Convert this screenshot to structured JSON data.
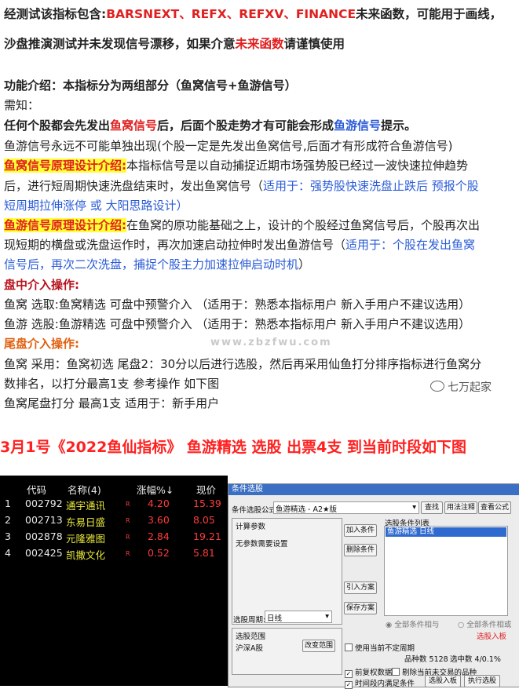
{
  "lines": {
    "l1_a": "经测试该指标包含:",
    "l1_b": "BARSNEXT、REFX、REFXV、FINANCE",
    "l1_c": "未来函数，可能用于画线，",
    "l2_a": "沙盘推演测试并未发现信号漂移，如果介意",
    "l2_b": "未来函数",
    "l2_c": "请谨慎使用",
    "l3": "功能介绍：本指标分为两组部分（鱼窝信号+鱼游信号）",
    "l4": "需知：",
    "l5_a": "任何个股都会先发出",
    "l5_b": "鱼窝信号",
    "l5_c": "后，后面个股走势才有可能会形成",
    "l5_d": "鱼游信号",
    "l5_e": "提示。",
    "l6": "鱼游信号永远不可能单独出现(个股一定是先发出鱼窝信号,后面才有形成符合鱼游信号)",
    "l7_a": "鱼窝信号原理设计介绍:",
    "l7_b": "本指标信号是以自动捕捉近期市场强势股已经过一波快速拉伸趋势",
    "l8_a": "后，进行短周期快速洗盘结束时，发出鱼窝信号（",
    "l8_b": "适用于：强势股快速洗盘止跌后 预报个股",
    "l9": "短周期拉伸涨停 或 大阳思路设计）",
    "l10_a": "鱼游信号原理设计介绍:",
    "l10_b": "在鱼窝的原功能基础之上，设计的个股经过鱼窝信号后，个股再次出",
    "l11_a": "现短期的横盘或洗盘运作时，再次加速启动拉伸时发出鱼游信号（",
    "l11_b": "适用于：个股在发出鱼窝",
    "l12_a": "信号后，再次二次洗盘，捕捉个股主力加速拉伸启动时机",
    "l12_b": "）",
    "l13": "盘中介入操作:",
    "l14": "鱼窝 选取:鱼窝精选 可盘中预警介入  （适用于：熟悉本指标用户 新入手用户不建议选用）",
    "l15": "鱼游 选股:鱼游精选 可盘中预警介入  （适用于：熟悉本指标用户 新入手用户不建议选用）",
    "l16": "尾盘介入操作:",
    "l17": "鱼窝 采用：鱼窝初选 尾盘2：30分以后进行选股，然后再采用仙鱼打分排序指标进行鱼窝分",
    "l18": "数排名，以打分最高1支 参考操作 如下图",
    "l19": "鱼窝尾盘打分 最高1支 适用于：新手用户",
    "title": "3月1号《2022鱼仙指标》 鱼游精选 选股 出票4支 到当前时段如下图",
    "watermark": "www.zbzfwu.com",
    "wechat": "七万起家"
  },
  "terminal": {
    "headers": [
      "代码",
      "名称(4)",
      "涨幅%↓",
      "现价"
    ],
    "rows": [
      {
        "idx": "1",
        "code": "002792",
        "name": "通宇通讯",
        "flag": "R",
        "chg": "4.20",
        "price": "15.39"
      },
      {
        "idx": "2",
        "code": "002713",
        "name": "东易日盛",
        "flag": "R",
        "chg": "3.60",
        "price": "8.05"
      },
      {
        "idx": "3",
        "code": "002878",
        "name": "元隆雅图",
        "flag": "R",
        "chg": "2.84",
        "price": "19.21"
      },
      {
        "idx": "4",
        "code": "002425",
        "name": "凯撒文化",
        "flag": "R",
        "chg": "0.52",
        "price": "5.81"
      }
    ]
  },
  "dialog": {
    "title": "条件选股",
    "formula_label": "条件选股公式",
    "formula_value": "鱼游精选  - A2★版",
    "btn_find": "查找",
    "btn_usage": "用法注释",
    "btn_view": "查看公式",
    "calc_params": "计算参数",
    "no_params": "无参数需要设置",
    "btn_add": "加入条件",
    "btn_delete": "删除条件",
    "list_header": "选股条件列表",
    "list_item": "鱼游精选  日线",
    "btn_import": "引入方案",
    "btn_save": "保存方案",
    "period_label": "选股周期:",
    "period_value": "日线",
    "radio_all": "全部条件相与",
    "radio_any": "全部条件相或",
    "stock_range": "选股范围",
    "range_value": "沪深A股",
    "btn_change": "改变范围",
    "sel_to_board": "选股入板",
    "use_period": "使用当前不定周期",
    "count_label": "品种数",
    "count_value": "5128",
    "selected_label": "选中数",
    "selected_value": "4/0.1%",
    "chk_weight": "前复权数据",
    "chk_exclude": "剔除当前未交易的品种",
    "chk_time": "时间段内满足条件",
    "btn_select_board": "选股入板",
    "btn_execute": "执行选股"
  }
}
